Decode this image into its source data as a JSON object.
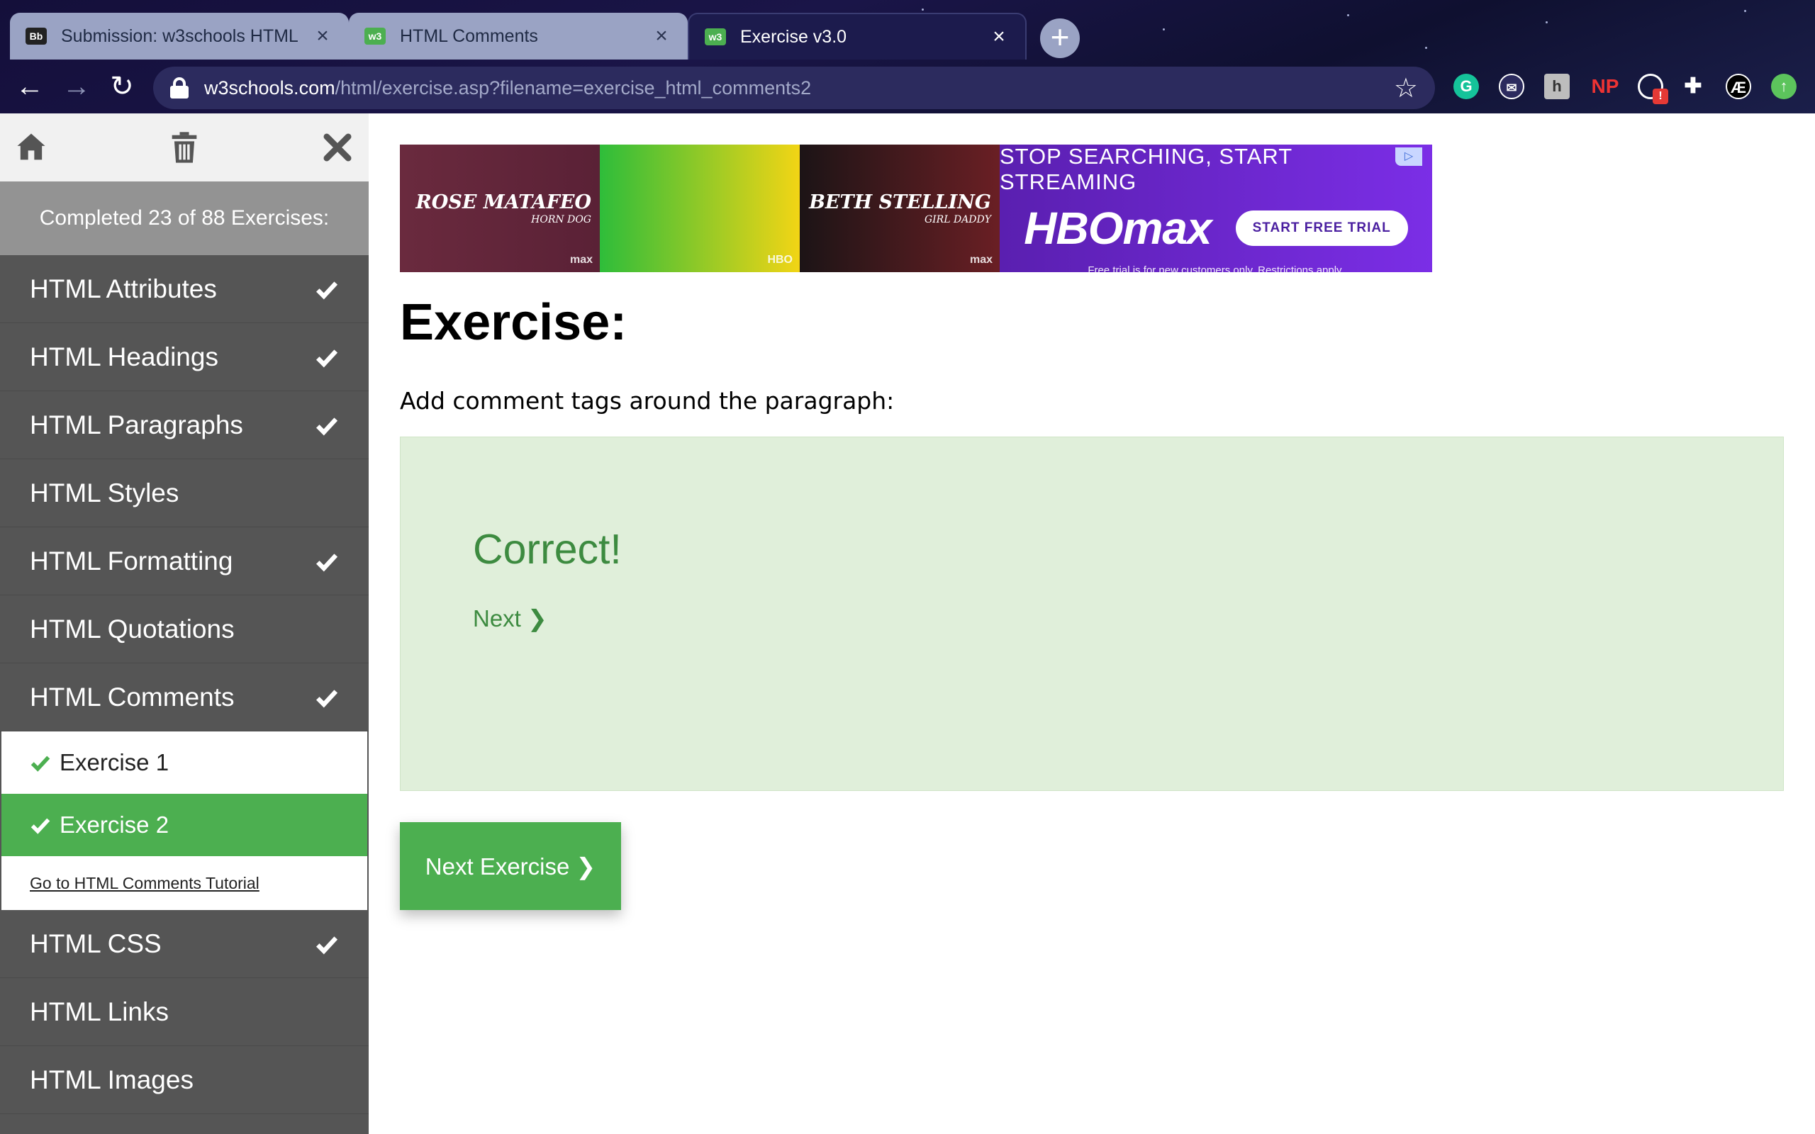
{
  "browser": {
    "tabs": [
      {
        "title": "Submission: w3schools HTML",
        "favicon": "Bb",
        "active": false
      },
      {
        "title": "HTML Comments",
        "favicon": "w3",
        "active": false
      },
      {
        "title": "Exercise v3.0",
        "favicon": "w3",
        "active": true
      }
    ],
    "url_host": "w3schools.com",
    "url_path": "/html/exercise.asp?filename=exercise_html_comments2",
    "extensions": [
      "grammarly-icon",
      "mail-icon",
      "hypothesis-icon",
      "np-icon",
      "badge-icon",
      "puzzle-icon",
      "profile-icon",
      "update-icon"
    ],
    "np_label": "NP",
    "badge_label": "!"
  },
  "sidebar": {
    "completed": "Completed 23 of 88 Exercises:",
    "items": [
      {
        "label": "HTML Attributes",
        "done": true
      },
      {
        "label": "HTML Headings",
        "done": true
      },
      {
        "label": "HTML Paragraphs",
        "done": true
      },
      {
        "label": "HTML Styles",
        "done": false
      },
      {
        "label": "HTML Formatting",
        "done": true
      },
      {
        "label": "HTML Quotations",
        "done": false
      },
      {
        "label": "HTML Comments",
        "done": true
      }
    ],
    "sub_items": [
      {
        "label": "Exercise 1",
        "done": true
      },
      {
        "label": "Exercise 2",
        "done": true,
        "selected": true
      }
    ],
    "tutorial_link": "Go to HTML Comments Tutorial",
    "items_after": [
      {
        "label": "HTML CSS",
        "done": true
      },
      {
        "label": "HTML Links",
        "done": false
      },
      {
        "label": "HTML Images",
        "done": false
      }
    ]
  },
  "ad": {
    "panel1": "ROSE MATAFEO",
    "panel1_sub": "HORN DOG",
    "panel1_tag": "max",
    "panel2_tag": "HBO",
    "panel3": "BETH STELLING",
    "panel3_sub": "GIRL DADDY",
    "panel3_tag": "max",
    "headline": "STOP SEARCHING, START STREAMING",
    "logo": "HBOmax",
    "cta": "START FREE TRIAL",
    "fine_print": "Free trial is for new customers only. Restrictions apply."
  },
  "main": {
    "title": "Exercise:",
    "instruction": "Add comment tags around the paragraph:",
    "result": "Correct!",
    "next_link": "Next ❯",
    "next_button": "Next Exercise ❯"
  },
  "colors": {
    "accent": "#4caf50",
    "sidebar_bg": "#555555",
    "result_bg": "#e0efda",
    "result_text": "#3d8b40"
  }
}
